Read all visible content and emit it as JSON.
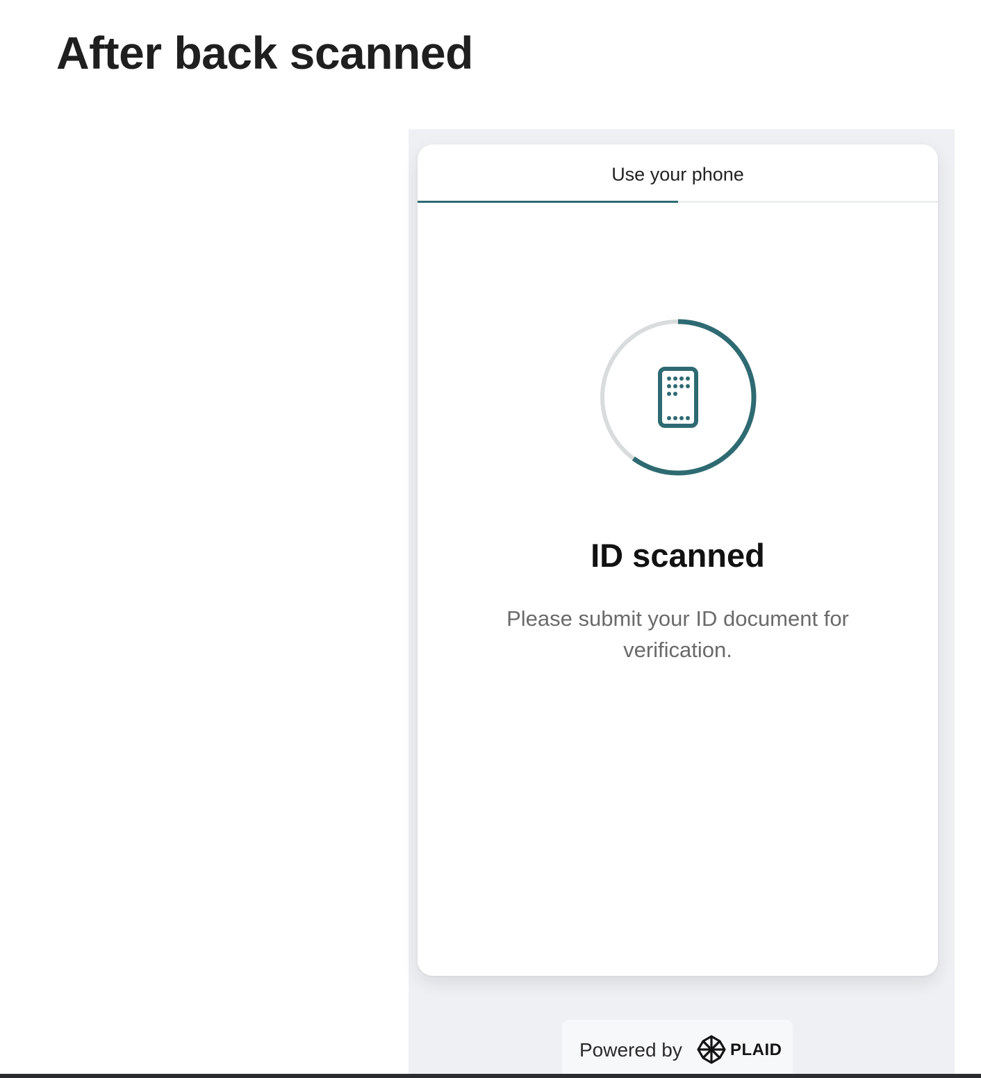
{
  "page": {
    "heading": "After back scanned"
  },
  "flow": {
    "tab": {
      "label": "Use your phone",
      "progress_fraction": 0.5
    },
    "status": {
      "icon": "phone-icon",
      "ring_progress_fraction": 0.6,
      "title": "ID scanned",
      "message": "Please submit your ID document for verification."
    }
  },
  "footer": {
    "powered_by": "Powered by",
    "brand_icon": "plaid-logo-icon",
    "brand": "PLAID"
  },
  "colors": {
    "accent": "#2e6a72",
    "ring_track": "#d9dcdd",
    "frame_background": "#eff0f3",
    "card_background": "#ffffff",
    "title_text": "#121212",
    "message_text": "#6a6a6a"
  }
}
